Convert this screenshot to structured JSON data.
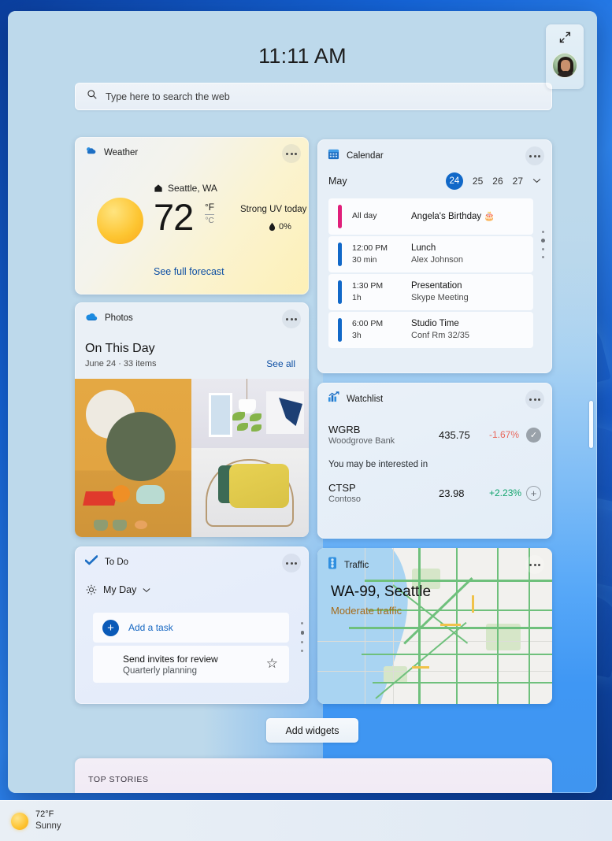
{
  "header": {
    "clock": "11:11 AM",
    "search_placeholder": "Type here to search the web",
    "search_value": "",
    "expand_icon": "expand-diagonal-icon",
    "avatar_alt": "user-avatar"
  },
  "widgets": {
    "weather": {
      "name": "Weather",
      "icon": "partly-cloudy-icon",
      "location": "Seattle, WA",
      "home_icon": "home-icon",
      "temperature": "72",
      "unit_primary": "°F",
      "unit_secondary": "°C",
      "uv_text": "Strong UV today",
      "precip_icon": "droplet-icon",
      "precip": "0%",
      "link": "See full forecast",
      "more_icon": "more-options-icon"
    },
    "calendar": {
      "name": "Calendar",
      "icon": "calendar-icon",
      "month": "May",
      "days": [
        "24",
        "25",
        "26",
        "27"
      ],
      "selected_day": "24",
      "chevron_icon": "chevron-down-icon",
      "more_icon": "more-options-icon",
      "events": [
        {
          "time": "All day",
          "duration": "",
          "title": "Angela's Birthday 🎂",
          "subtitle": "",
          "color": "#e01f7a"
        },
        {
          "time": "12:00 PM",
          "duration": "30 min",
          "title": "Lunch",
          "subtitle": "Alex Johnson",
          "color": "#1168c8"
        },
        {
          "time": "1:30 PM",
          "duration": "1h",
          "title": "Presentation",
          "subtitle": "Skype Meeting",
          "color": "#1168c8"
        },
        {
          "time": "6:00 PM",
          "duration": "3h",
          "title": "Studio Time",
          "subtitle": "Conf Rm 32/35",
          "color": "#1168c8"
        }
      ]
    },
    "photos": {
      "name": "Photos",
      "icon": "onedrive-cloud-icon",
      "title": "On This Day",
      "subtitle": "June 24 · 33 items",
      "see_all": "See all",
      "more_icon": "more-options-icon"
    },
    "watchlist": {
      "name": "Watchlist",
      "icon": "stocks-chart-icon",
      "more_icon": "more-options-icon",
      "note": "You may be interested in",
      "rows": [
        {
          "symbol": "WGRB",
          "company": "Woodgrove Bank",
          "price": "435.75",
          "change": "-1.67%",
          "change_color": "#e8695e",
          "action_icon": "check-icon"
        },
        {
          "symbol": "CTSP",
          "company": "Contoso",
          "price": "23.98",
          "change": "+2.23%",
          "change_color": "#10a36b",
          "action_icon": "plus-icon"
        }
      ]
    },
    "todo": {
      "name": "To Do",
      "icon": "checkmark-icon",
      "more_icon": "more-options-icon",
      "list_icon": "sun-icon",
      "list_name": "My Day",
      "chevron_icon": "chevron-down-icon",
      "add_icon": "plus-circle-icon",
      "add_label": "Add a task",
      "task_title": "Send invites for review",
      "task_subtitle": "Quarterly planning",
      "star_icon": "star-outline-icon"
    },
    "traffic": {
      "name": "Traffic",
      "icon": "traffic-light-icon",
      "more_icon": "more-options-icon",
      "route": "WA-99, Seattle",
      "status": "Moderate traffic",
      "status_color": "#a56a18"
    }
  },
  "footer": {
    "add_widgets": "Add widgets",
    "top_stories": "TOP STORIES"
  },
  "taskbar": {
    "weather_temp": "72°F",
    "weather_condition": "Sunny",
    "weather_icon": "sun-icon"
  },
  "colors": {
    "accent": "#1168c8",
    "link": "#0e4fa3",
    "birthday": "#e01f7a"
  }
}
